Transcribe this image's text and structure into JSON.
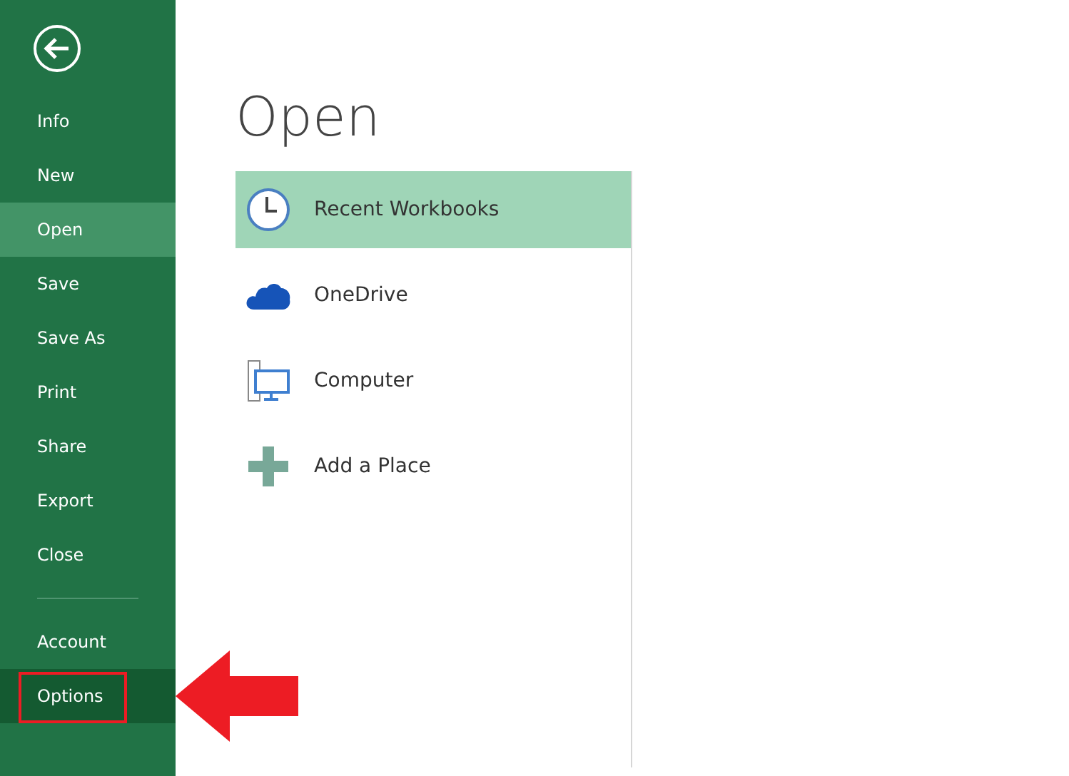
{
  "sidebar": {
    "items": [
      {
        "label": "Info",
        "selected": false,
        "hovered": false
      },
      {
        "label": "New",
        "selected": false,
        "hovered": false
      },
      {
        "label": "Open",
        "selected": true,
        "hovered": false
      },
      {
        "label": "Save",
        "selected": false,
        "hovered": false
      },
      {
        "label": "Save As",
        "selected": false,
        "hovered": false
      },
      {
        "label": "Print",
        "selected": false,
        "hovered": false
      },
      {
        "label": "Share",
        "selected": false,
        "hovered": false
      },
      {
        "label": "Export",
        "selected": false,
        "hovered": false
      },
      {
        "label": "Close",
        "selected": false,
        "hovered": false
      }
    ],
    "bottom_items": [
      {
        "label": "Account",
        "selected": false,
        "hovered": false,
        "callout": false
      },
      {
        "label": "Options",
        "selected": false,
        "hovered": true,
        "callout": true
      }
    ]
  },
  "title": "Open",
  "places": [
    {
      "label": "Recent Workbooks",
      "kind": "clock",
      "selected": true
    },
    {
      "label": "OneDrive",
      "kind": "cloud",
      "selected": false
    },
    {
      "label": "Computer",
      "kind": "computer",
      "selected": false
    },
    {
      "label": "Add a Place",
      "kind": "plus",
      "selected": false
    }
  ]
}
